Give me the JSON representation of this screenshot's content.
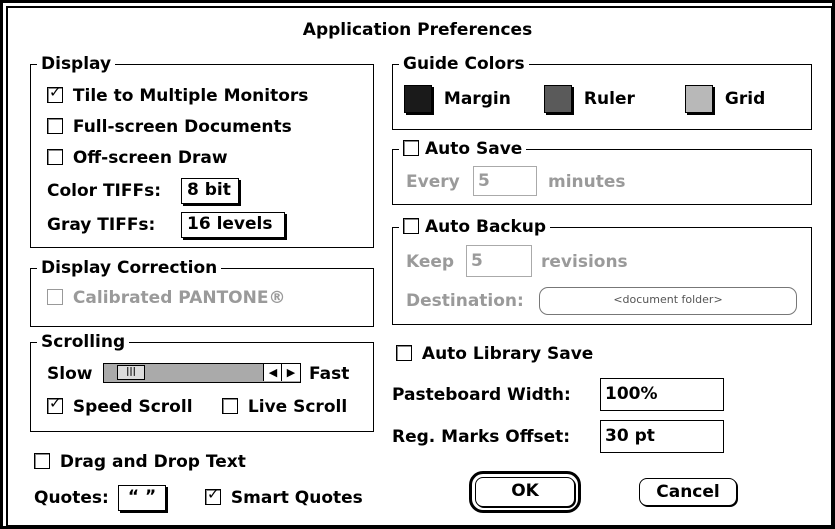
{
  "dialog": {
    "title": "Application Preferences"
  },
  "display": {
    "legend": "Display",
    "tile_label": "Tile to Multiple Monitors",
    "tile_checked": true,
    "fullscreen_label": "Full-screen Documents",
    "fullscreen_checked": false,
    "offscreen_label": "Off-screen Draw",
    "offscreen_checked": false,
    "color_tiffs_label": "Color TIFFs:",
    "color_tiffs_value": "8 bit",
    "gray_tiffs_label": "Gray TIFFs:",
    "gray_tiffs_value": "16 levels"
  },
  "display_correction": {
    "legend": "Display Correction",
    "pantone_label": "Calibrated PANTONE®",
    "pantone_checked": false,
    "pantone_enabled": false
  },
  "scrolling": {
    "legend": "Scrolling",
    "slow_label": "Slow",
    "fast_label": "Fast",
    "speed_fraction": 0.1,
    "speed_scroll_label": "Speed Scroll",
    "speed_scroll_checked": true,
    "live_scroll_label": "Live Scroll",
    "live_scroll_checked": false
  },
  "drag_drop": {
    "label": "Drag and Drop Text",
    "checked": false
  },
  "quotes": {
    "label": "Quotes:",
    "value": "“ ”",
    "smart_label": "Smart Quotes",
    "smart_checked": true
  },
  "guide_colors": {
    "legend": "Guide Colors",
    "items": [
      {
        "label": "Margin",
        "color": "#1a1a1a"
      },
      {
        "label": "Ruler",
        "color": "#5a5a5a"
      },
      {
        "label": "Grid",
        "color": "#b8b8b8"
      }
    ]
  },
  "auto_save": {
    "label": "Auto Save",
    "checked": false,
    "every_label": "Every",
    "value": "5",
    "unit": "minutes"
  },
  "auto_backup": {
    "label": "Auto Backup",
    "checked": false,
    "keep_label": "Keep",
    "value": "5",
    "unit": "revisions",
    "destination_label": "Destination:",
    "destination_value": "<document folder>"
  },
  "auto_library": {
    "label": "Auto Library Save",
    "checked": false
  },
  "pasteboard": {
    "label": "Pasteboard Width:",
    "value": "100%"
  },
  "reg_marks": {
    "label": "Reg. Marks Offset:",
    "value": "30  pt"
  },
  "buttons": {
    "ok": "OK",
    "cancel": "Cancel"
  }
}
